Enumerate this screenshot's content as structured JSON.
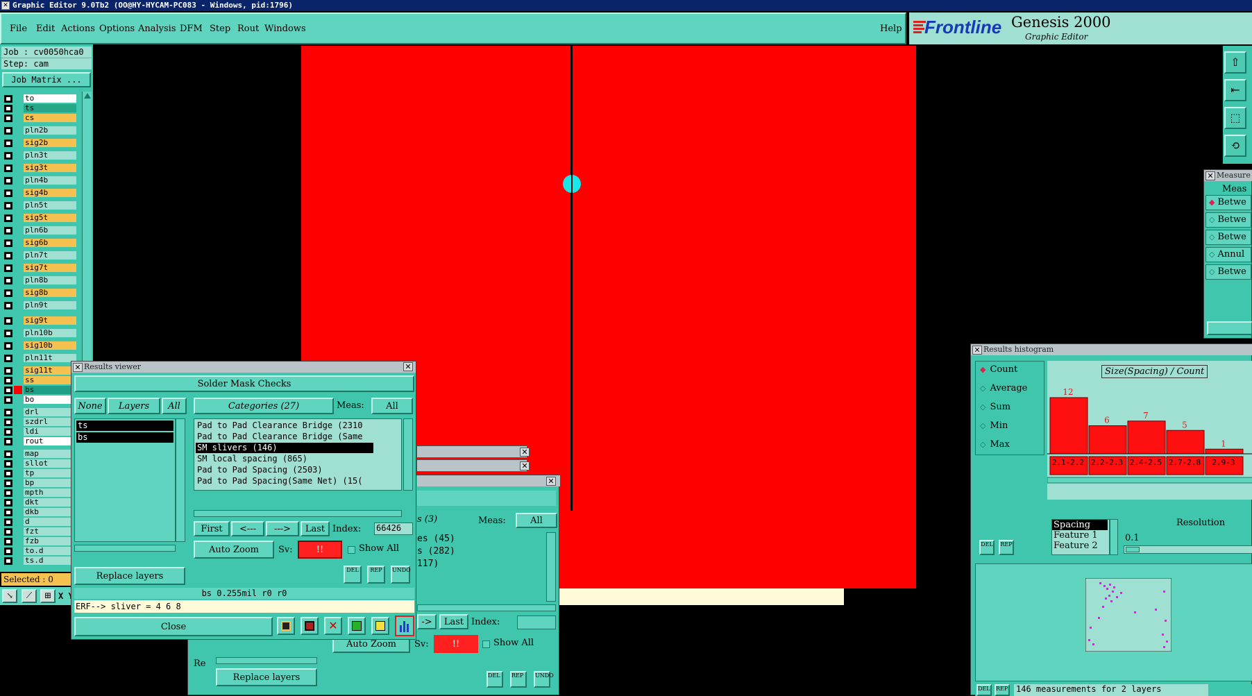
{
  "window": {
    "title": "Graphic Editor 9.0Tb2 (OO@HY-HYCAM-PC083 - Windows, pid:1796)"
  },
  "menu": {
    "items": [
      "File",
      "Edit",
      "Actions",
      "Options",
      "Analysis",
      "DFM",
      "Step",
      "Rout",
      "Windows"
    ],
    "help": "Help"
  },
  "brand": {
    "logo": "Frontline",
    "product": "Genesis 2000",
    "subtitle": "Graphic Editor"
  },
  "job": {
    "job_label": "Job : cv0050hca0",
    "step_label": "Step: cam",
    "matrix_button": "Job Matrix ..."
  },
  "layers": [
    {
      "name": "to",
      "color": "#ffffff"
    },
    {
      "name": "ts",
      "color": "#26a888"
    },
    {
      "name": "cs",
      "color": "#f5c252"
    },
    {
      "name": "pln2b",
      "color": "#9fe0d2"
    },
    {
      "name": "sig2b",
      "color": "#f5c252"
    },
    {
      "name": "pln3t",
      "color": "#9fe0d2"
    },
    {
      "name": "sig3t",
      "color": "#f5c252"
    },
    {
      "name": "pln4b",
      "color": "#9fe0d2"
    },
    {
      "name": "sig4b",
      "color": "#f5c252"
    },
    {
      "name": "pln5t",
      "color": "#9fe0d2"
    },
    {
      "name": "sig5t",
      "color": "#f5c252"
    },
    {
      "name": "pln6b",
      "color": "#9fe0d2"
    },
    {
      "name": "sig6b",
      "color": "#f5c252"
    },
    {
      "name": "pln7t",
      "color": "#9fe0d2"
    },
    {
      "name": "sig7t",
      "color": "#f5c252"
    },
    {
      "name": "pln8b",
      "color": "#9fe0d2"
    },
    {
      "name": "sig8b",
      "color": "#f5c252"
    },
    {
      "name": "pln9t",
      "color": "#9fe0d2"
    },
    {
      "name": "sig9t",
      "color": "#f5c252"
    },
    {
      "name": "pln10b",
      "color": "#9fe0d2"
    },
    {
      "name": "sig10b",
      "color": "#f5c252"
    },
    {
      "name": "pln11t",
      "color": "#9fe0d2"
    },
    {
      "name": "sig11t",
      "color": "#f5c252"
    },
    {
      "name": "ss",
      "color": "#f5c252"
    },
    {
      "name": "bs",
      "color": "#1f9f86"
    },
    {
      "name": "bo",
      "color": "#ffffff"
    },
    {
      "name": "drl",
      "color": "#9fe0d2"
    },
    {
      "name": "szdrl",
      "color": "#9fe0d2"
    },
    {
      "name": "ldi",
      "color": "#9fe0d2"
    },
    {
      "name": "rout",
      "color": "#ffffff"
    },
    {
      "name": "map",
      "color": "#9fe0d2"
    },
    {
      "name": "sllot",
      "color": "#9fe0d2"
    },
    {
      "name": "tp",
      "color": "#9fe0d2"
    },
    {
      "name": "bp",
      "color": "#9fe0d2"
    },
    {
      "name": "mpth",
      "color": "#9fe0d2"
    },
    {
      "name": "dkt",
      "color": "#9fe0d2"
    },
    {
      "name": "dkb",
      "color": "#9fe0d2"
    },
    {
      "name": "d",
      "color": "#9fe0d2"
    },
    {
      "name": "fzt",
      "color": "#9fe0d2"
    },
    {
      "name": "fzb",
      "color": "#9fe0d2"
    },
    {
      "name": "to.d",
      "color": "#9fe0d2"
    },
    {
      "name": "ts.d",
      "color": "#9fe0d2"
    }
  ],
  "selected": "Selected : 0",
  "xy_label": "X Y :",
  "results_viewer": {
    "title": "Results viewer",
    "heading": "Solder Mask Checks",
    "none_btn": "None",
    "layers_btn": "Layers",
    "all_btn": "All",
    "categories_btn": "Categories (27)",
    "meas_label": "Meas:",
    "meas_value": "All",
    "layer_list": [
      "ts",
      "bs"
    ],
    "categories": [
      "Pad to Pad Clearance Bridge (2310",
      "Pad to Pad Clearance Bridge (Same",
      "SM slivers (146)",
      "SM local spacing (865)",
      "Pad to Pad Spacing (2503)",
      "Pad to Pad Spacing(Same Net) (15("
    ],
    "first": "First",
    "prev": "<---",
    "next": "--->",
    "last": "Last",
    "index_label": "Index:",
    "index_value": "66426",
    "auto_zoom": "Auto Zoom",
    "sv_label": "Sv:",
    "sv_value": "!!",
    "show_all": "Show All",
    "replace_layers": "Replace layers",
    "status": "bs 0.255mil  r0  r0",
    "erf": "ERF--> sliver = 4 6 8",
    "close": "Close",
    "icon_del": "DEL",
    "icon_rep": "REP",
    "icon_undo": "UNDO"
  },
  "behind_viewer": {
    "cat_text": "s (3)",
    "meas_label": "Meas:",
    "meas_value": "All",
    "items": [
      "es (45)",
      "s (282)",
      "117)"
    ],
    "last": "Last",
    "index_label": "Index:",
    "prev_tail": "->",
    "auto_zoom": "Auto Zoom",
    "sv_label": "Sv:",
    "sv_value": "!!",
    "show_all": "Show All",
    "replace_layers": "Replace layers",
    "re": "Re",
    "icon_del": "DEL",
    "icon_rep": "REP",
    "icon_undo": "UNDO"
  },
  "measure": {
    "title": "Measure",
    "header": "Meas",
    "options": [
      "Betwe",
      "Betwe",
      "Betwe",
      "Annul",
      "Betwe"
    ]
  },
  "histogram": {
    "title": "Results histogram",
    "options": [
      "Count",
      "Average",
      "Sum",
      "Min",
      "Max"
    ],
    "chart_title": "Size(Spacing) / Count",
    "list": [
      "Spacing",
      "Feature 1",
      "Feature 2"
    ],
    "resolution_label": "Resolution",
    "resolution_value": "0.1",
    "status": "146 measurements for 2 layers",
    "icon_del": "DEL",
    "icon_rep": "REP"
  },
  "chart_data": {
    "type": "bar",
    "title": "Size(Spacing) / Count",
    "categories": [
      "2.1-2.2",
      "2.2-2.3",
      "2.4-2.5",
      "2.7-2.8",
      "2.9-3"
    ],
    "values": [
      12,
      6,
      7,
      5,
      1
    ],
    "ylim": [
      0,
      14
    ]
  },
  "colors": {
    "board": "#ff0000",
    "canvas": "#000000",
    "teal": "#5fd4bf",
    "selection": "#000000"
  }
}
